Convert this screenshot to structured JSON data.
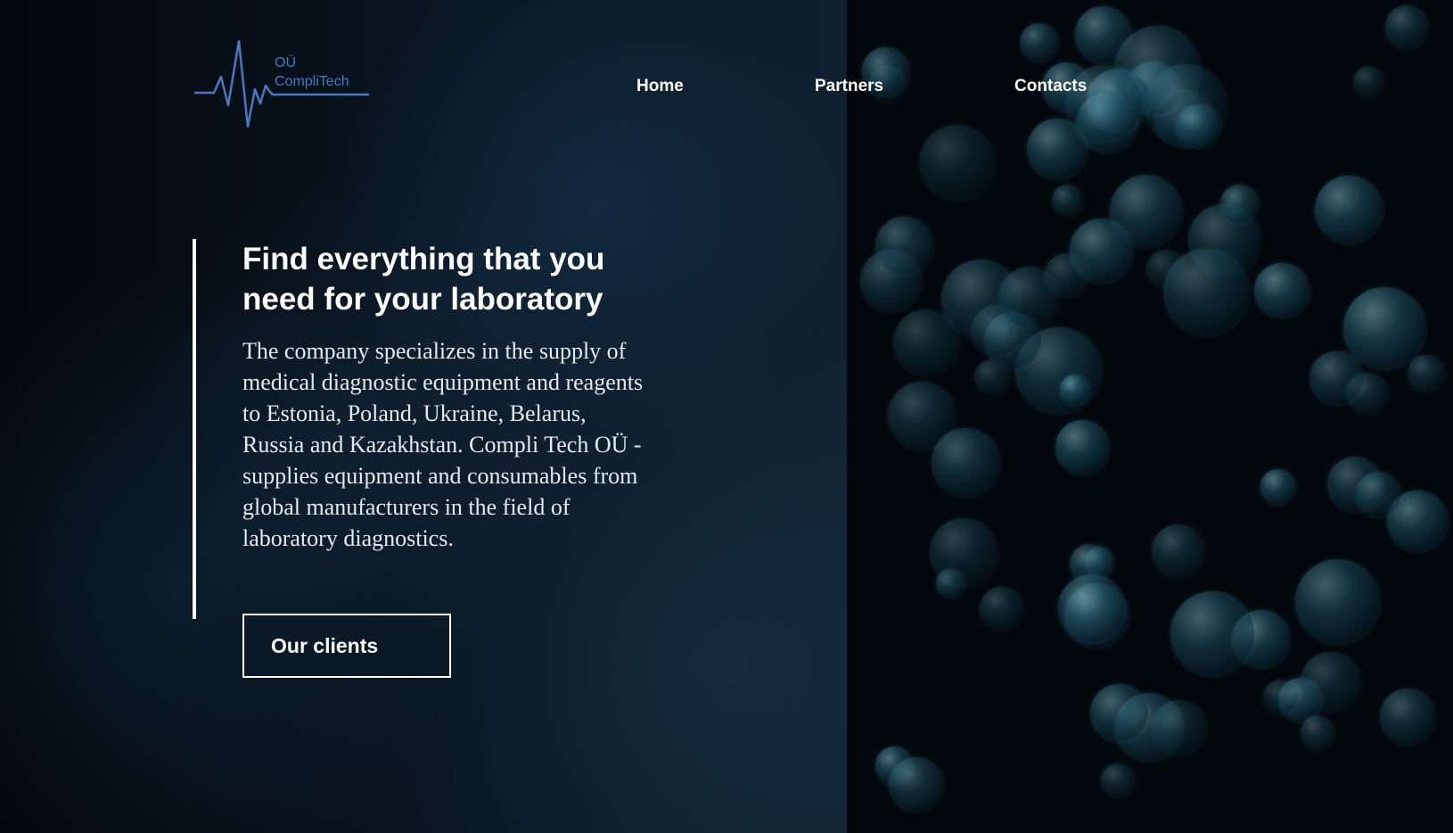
{
  "logo": {
    "line1": "OÜ",
    "line2": "CompliTech",
    "icon": "heartbeat-icon",
    "color": "#4a78c0"
  },
  "nav": {
    "items": [
      {
        "label": "Home"
      },
      {
        "label": "Partners"
      },
      {
        "label": "Contacts"
      }
    ]
  },
  "hero": {
    "title": "Find everything that you need for your laboratory",
    "description": "The company specializes in the supply of medical diagnostic equipment and reagents to Estonia, Poland, Ukraine, Belarus, Russia and Kazakhstan. Compli Tech OÜ - supplies equipment and consumables from global manufacturers in the field of laboratory diagnostics.",
    "cta_label": "Our clients"
  },
  "colors": {
    "text": "#ffffff",
    "accent": "#4a78c0",
    "background": "#050a10"
  }
}
